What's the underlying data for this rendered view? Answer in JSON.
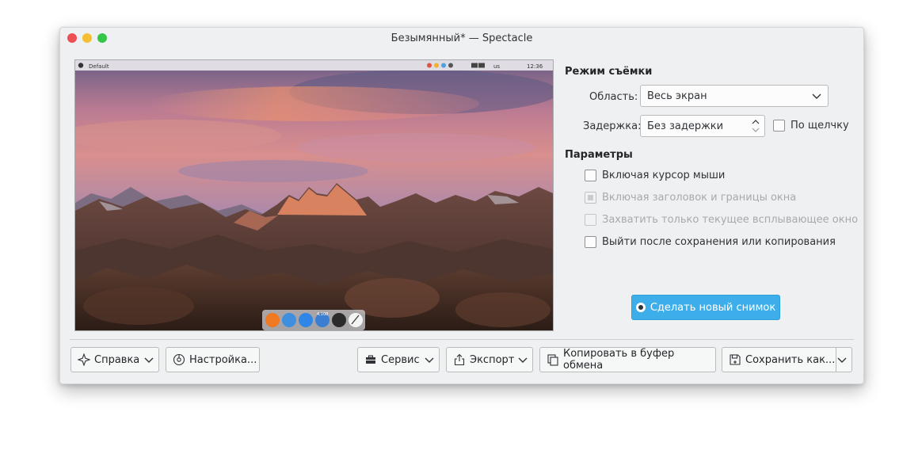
{
  "window": {
    "title": "Безымянный* — Spectacle"
  },
  "preview": {
    "menubar_app": "Default",
    "clock": "12:36",
    "keyboard_layout": "us",
    "dock_badge": "4,108"
  },
  "capture_mode": {
    "heading": "Режим съёмки",
    "area_label": "Область:",
    "area_value": "Весь экран",
    "delay_label": "Задержка:",
    "delay_value": "Без задержки",
    "on_click_label": "По щелчку"
  },
  "options": {
    "heading": "Параметры",
    "include_cursor": "Включая курсор мыши",
    "include_decorations": "Включая заголовок и границы окна",
    "popup_only": "Захватить только текущее всплывающее окно",
    "quit_after_save": "Выйти после сохранения или копирования"
  },
  "new_screenshot_label": "Сделать новый снимок",
  "toolbar": {
    "help": "Справка",
    "configure": "Настройка...",
    "tools": "Сервис",
    "export": "Экспорт",
    "copy": "Копировать в буфер обмена",
    "save_as": "Сохранить как..."
  },
  "colors": {
    "accent": "#3daee9",
    "window_bg": "#eff0f1",
    "close": "#ed4f57",
    "minimize": "#f5bf33",
    "maximize": "#33c648"
  }
}
